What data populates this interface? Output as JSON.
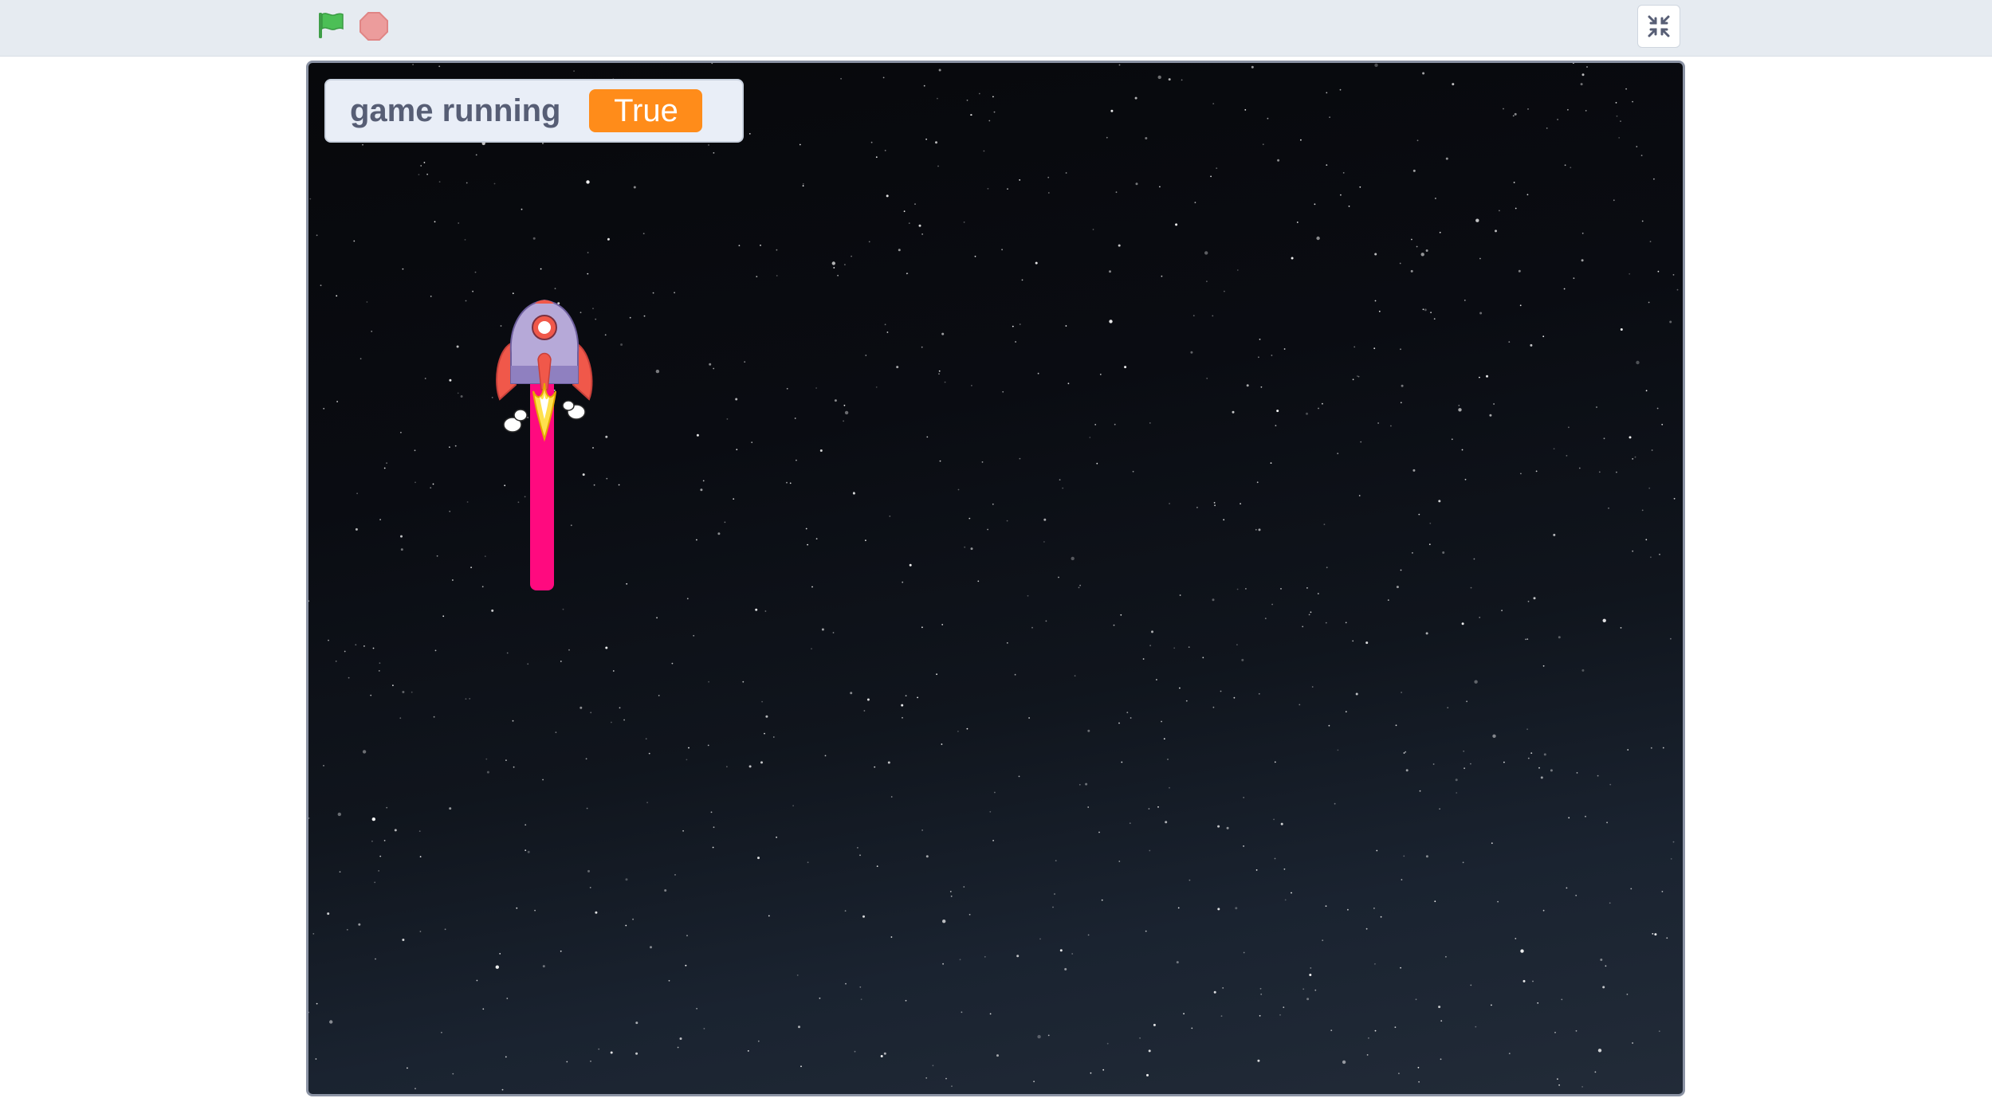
{
  "toolbar": {
    "green_flag_icon": "green-flag-icon",
    "stop_icon": "stop-sign-icon",
    "fullscreen_icon": "exit-fullscreen-icon",
    "colors": {
      "bar": "#e6ebf1",
      "flag": "#4cbf56",
      "stop": "#ec9c9c"
    }
  },
  "stage": {
    "background": "starfield",
    "monitor": {
      "label": "game running",
      "value": "True",
      "value_color": "#ff8c1a"
    },
    "sprite": {
      "name_icon": "rocket-icon",
      "trail_color": "#ff0a7f"
    }
  }
}
